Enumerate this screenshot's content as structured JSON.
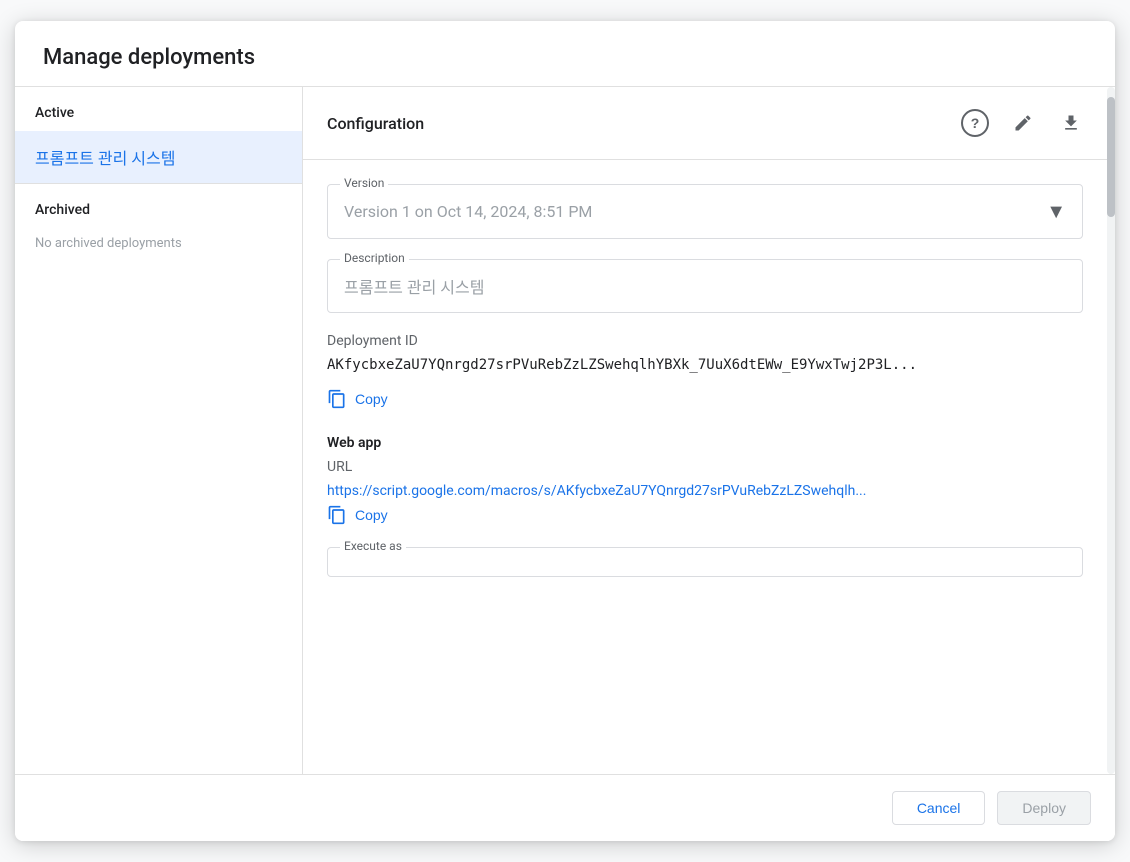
{
  "dialog": {
    "title": "Manage deployments"
  },
  "sidebar": {
    "active_label": "Active",
    "active_deployment": "프롬프트 관리 시스템",
    "archived_label": "Archived",
    "no_archived": "No archived deployments"
  },
  "main": {
    "header_title": "Configuration",
    "version_label": "Version",
    "version_value": "Version 1 on Oct 14, 2024, 8:51 PM",
    "description_label": "Description",
    "description_value": "프롬프트 관리 시스템",
    "deployment_id_label": "Deployment ID",
    "deployment_id_value": "AKfycbxeZaU7YQnrgd27srPVuRebZzLZSwehqlhYBXk_7UuX6dtEWw_E9YwxTwj2P3L...",
    "copy_label_1": "Copy",
    "web_app_label": "Web app",
    "url_label": "URL",
    "url_value": "https://script.google.com/macros/s/AKfycbxeZaU7YQnrgd27srPVuRebZzLZSwehqlh...",
    "copy_label_2": "Copy",
    "execute_as_label": "Execute as"
  },
  "footer": {
    "cancel_label": "Cancel",
    "deploy_label": "Deploy"
  },
  "icons": {
    "question": "?",
    "edit": "edit-icon",
    "download": "download-icon",
    "copy": "copy-icon",
    "dropdown": "▼"
  }
}
